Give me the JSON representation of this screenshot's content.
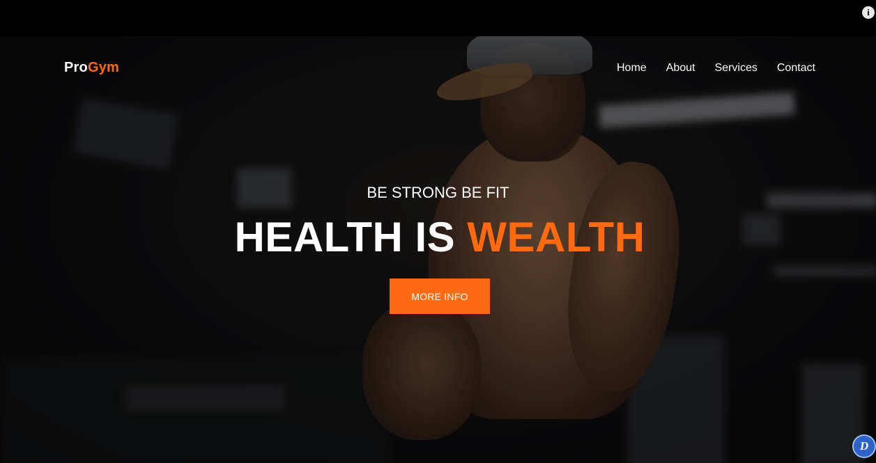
{
  "brand": {
    "part1": "Pro",
    "part2": "Gym"
  },
  "nav": {
    "items": [
      {
        "label": "Home"
      },
      {
        "label": "About"
      },
      {
        "label": "Services"
      },
      {
        "label": "Contact"
      }
    ]
  },
  "hero": {
    "tagline": "BE STRONG BE FIT",
    "headline_part1": "HEALTH IS ",
    "headline_part2": "WEALTH",
    "cta_label": "MORE INFO"
  },
  "overlay_icons": {
    "top_right": "info-icon",
    "bottom_right": "extension-badge-icon"
  },
  "overlay_text": {
    "info_glyph": "i",
    "badge_glyph": "D"
  },
  "colors": {
    "accent": "#ff6a13",
    "text": "#ffffff",
    "background": "#000000"
  }
}
